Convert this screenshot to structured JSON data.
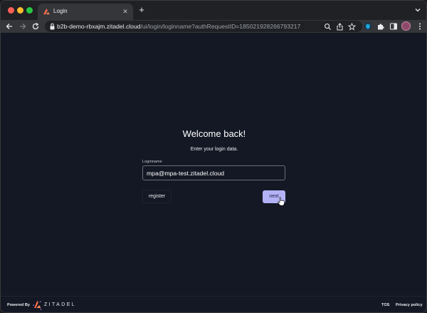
{
  "browser": {
    "tab_title": "Login",
    "new_tab_symbol": "+",
    "close_symbol": "✕",
    "url_host": "b2b-demo-rbxajm.zitadel.cloud",
    "url_path": "/ui/login/loginname?authRequestID=185021928266793217"
  },
  "login": {
    "title": "Welcome back!",
    "subtitle": "Enter your login data.",
    "field_label": "Loginname",
    "field_value": "mpa@mpa-test.zitadel.cloud",
    "register_label": "register",
    "next_label": "next"
  },
  "footer": {
    "powered_by": "Powered By",
    "brand": "ZITADEL",
    "tos": "TOS",
    "privacy": "Privacy policy"
  },
  "colors": {
    "page_background": "#141824",
    "primary_button": "#b4b2f7",
    "brand_accent": "#ff6b4a"
  }
}
